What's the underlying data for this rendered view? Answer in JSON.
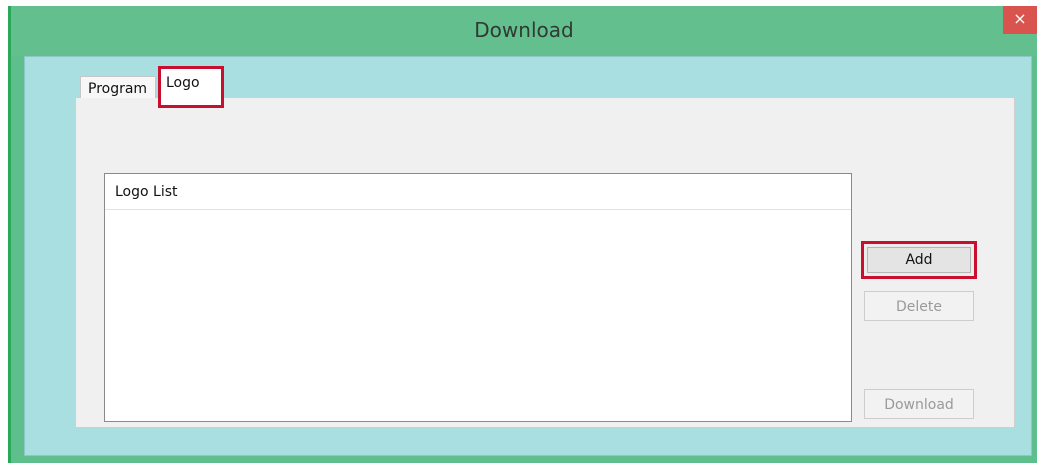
{
  "window": {
    "title": "Download",
    "close_glyph": "×"
  },
  "tabs": [
    {
      "label": "Program",
      "selected": false
    },
    {
      "label": "Logo",
      "selected": true
    }
  ],
  "logo_list": {
    "header": "Logo List",
    "items": []
  },
  "buttons": {
    "add": "Add",
    "delete": "Delete",
    "download": "Download"
  },
  "colors": {
    "titlebar": "#63c08e",
    "client": "#a9dfe0",
    "highlight": "#c8102e",
    "close": "#d9534f"
  }
}
